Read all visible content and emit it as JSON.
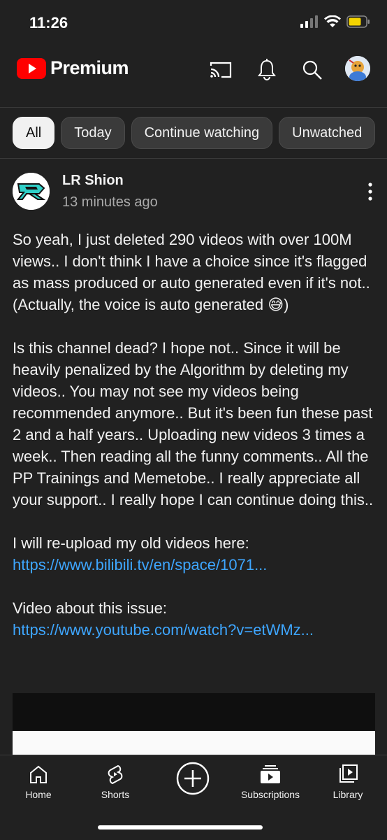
{
  "status_bar": {
    "time": "11:26"
  },
  "header": {
    "brand": "Premium"
  },
  "chips": [
    "All",
    "Today",
    "Continue watching",
    "Unwatched"
  ],
  "post": {
    "channel": "LR Shion",
    "time": "13 minutes ago",
    "paragraph1": "So yeah, I just deleted 290 videos with over 100M views.. I don't think I have a choice since it's flagged as mass produced or auto generated even if it's not.. (Actually, the voice is auto generated 😅)",
    "paragraph2": "Is this channel dead? I hope not.. Since it will be heavily penalized by the Algorithm by deleting my videos.. You may not see my videos being recommended anymore.. But it's been fun these past 2 and a half years.. Uploading new videos 3 times a week.. Then reading all the funny comments.. All the PP Trainings and Memetobe.. I really appreciate all your support.. I really hope I can continue doing this..",
    "reupload_text": "I will re-upload my old videos here:",
    "reupload_link": "https://www.bilibili.tv/en/space/1071...",
    "video_text": "Video about this issue:",
    "video_link": "https://www.youtube.com/watch?v=etWMz..."
  },
  "bottom_nav": {
    "home": "Home",
    "shorts": "Shorts",
    "subscriptions": "Subscriptions",
    "library": "Library"
  },
  "colors": {
    "background": "#212121",
    "link": "#3ea6ff",
    "brand_red": "#ff0000"
  }
}
